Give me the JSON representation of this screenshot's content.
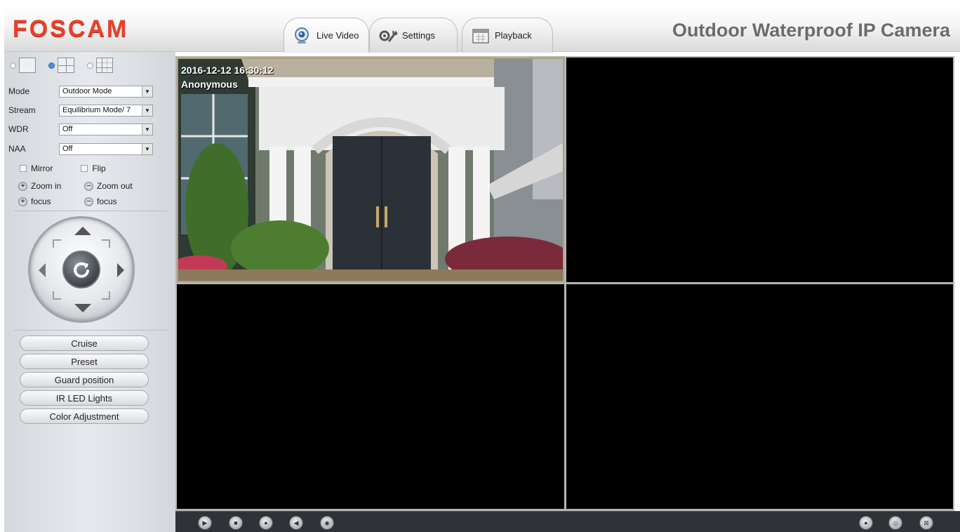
{
  "header": {
    "logo": "FOSCAM",
    "product_title": "Outdoor Waterproof IP Camera",
    "tabs": [
      {
        "label": "Live Video",
        "icon": "camera-icon",
        "active": true
      },
      {
        "label": "Settings",
        "icon": "gear-wrench-icon",
        "active": false
      },
      {
        "label": "Playback",
        "icon": "calendar-icon",
        "active": false
      }
    ]
  },
  "sidebar": {
    "layouts": [
      {
        "name": "1-view",
        "selected": false
      },
      {
        "name": "4-view",
        "selected": true
      },
      {
        "name": "9-view",
        "selected": false
      }
    ],
    "fields": [
      {
        "label": "Mode",
        "value": "Outdoor Mode"
      },
      {
        "label": "Stream",
        "value": "Equilibrium Mode/ 7"
      },
      {
        "label": "WDR",
        "value": "Off"
      },
      {
        "label": "NAA",
        "value": "Off"
      }
    ],
    "checks": {
      "mirror": "Mirror",
      "flip": "Flip"
    },
    "zoom_in": "Zoom in",
    "zoom_out": "Zoom out",
    "focus_plus": "focus",
    "focus_minus": "focus",
    "buttons": {
      "cruise": "Cruise",
      "preset": "Preset",
      "guard": "Guard position",
      "ir": "IR LED Lights",
      "color": "Color Adjustment"
    }
  },
  "video": {
    "timestamp": "2016-12-12 16:30:12",
    "camera_name": "Anonymous"
  },
  "colors": {
    "logo_red": "#e8402a",
    "title_gray": "#6b6b6b",
    "toolbar_bg": "#2f3338"
  }
}
